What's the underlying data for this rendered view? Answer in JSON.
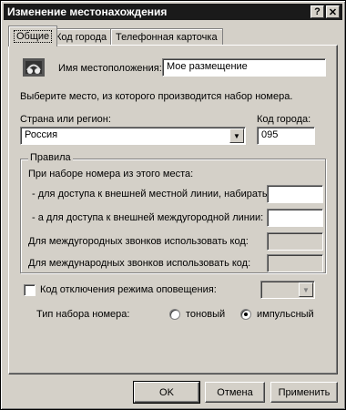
{
  "window": {
    "title": "Изменение местонахождения",
    "help_glyph": "?",
    "close_glyph": "✕"
  },
  "tabs": [
    {
      "label": "Общие"
    },
    {
      "label": "Код города"
    },
    {
      "label": "Телефонная карточка"
    }
  ],
  "general": {
    "location_name_label": "Имя местоположения:",
    "location_name_value": "Мое размещение",
    "select_place_text": "Выберите место, из которого производится набор номера.",
    "country_label": "Страна или регион:",
    "country_value": "Россия",
    "area_code_label": "Код города:",
    "area_code_value": "095"
  },
  "rules": {
    "title": "Правила",
    "dialing_from_here": "При наборе номера из этого места:",
    "local_line_label": "- для доступа к внешней местной линии, набирать:",
    "long_distance_line_label": "- а для доступа к внешней междугородной линии:",
    "long_distance_carrier_label": "Для междугородных звонков использовать код:",
    "international_carrier_label": "Для международных звонков использовать код:"
  },
  "call_waiting": {
    "label": "Код отключения режима оповещения:",
    "checked": false
  },
  "dial_type": {
    "label": "Тип набора номера:",
    "options": [
      {
        "label": "тоновый",
        "selected": false
      },
      {
        "label": "импульсный",
        "selected": true
      }
    ]
  },
  "buttons": {
    "ok": "OK",
    "cancel": "Отмена",
    "apply": "Применить"
  },
  "icons": {
    "location": "location-icon",
    "dropdown": "chevron-down-icon"
  }
}
